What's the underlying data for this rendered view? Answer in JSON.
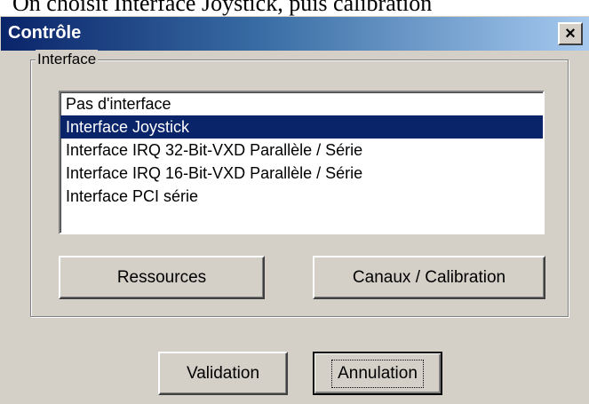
{
  "caption": "On choisit Interface Joystick, puis calibration",
  "window": {
    "title": "Contrôle",
    "close_glyph": "×"
  },
  "group": {
    "label": "Interface"
  },
  "list": {
    "items": [
      "Pas d'interface",
      "Interface Joystick",
      "Interface IRQ 32-Bit-VXD Parallèle / Série",
      "Interface IRQ 16-Bit-VXD Parallèle / Série",
      "Interface PCI série"
    ],
    "selected": "Interface Joystick"
  },
  "buttons": {
    "resources": "Ressources",
    "channels": "Canaux / Calibration",
    "validate": "Validation",
    "cancel": "Annulation"
  },
  "colors": {
    "selection": "#0a246a",
    "dialog_face": "#d4d0c8",
    "title_start": "#0a246a",
    "title_end": "#a6caf0"
  }
}
